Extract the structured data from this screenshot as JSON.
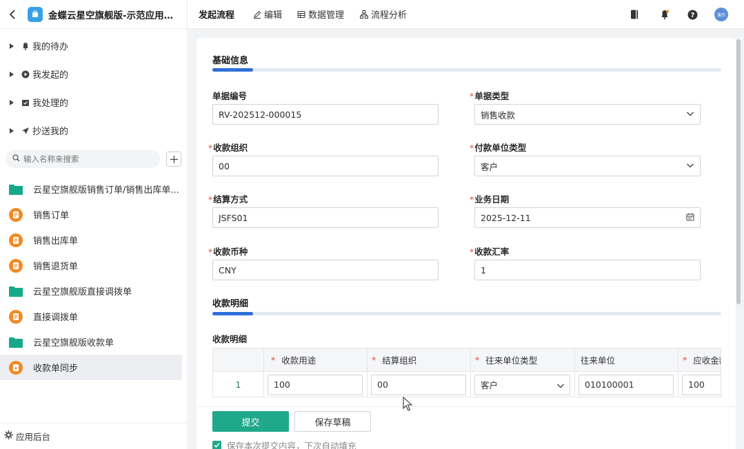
{
  "sidebar": {
    "app_title": "金蝶云星空旗舰版-示范应用_...",
    "nav": [
      {
        "label": "我的待办",
        "icon": "bell-icon"
      },
      {
        "label": "我发起的",
        "icon": "play-circle-icon"
      },
      {
        "label": "我处理的",
        "icon": "calendar-check-icon"
      },
      {
        "label": "抄送我的",
        "icon": "send-icon"
      }
    ],
    "search_placeholder": "输入名称来搜索",
    "docs": [
      {
        "label": "云星空旗舰版销售订单/销售出库单...",
        "icon": "folder-icon"
      },
      {
        "label": "销售订单",
        "icon": "form-icon"
      },
      {
        "label": "销售出库单",
        "icon": "form-icon"
      },
      {
        "label": "销售退货单",
        "icon": "form-icon"
      },
      {
        "label": "云星空旗舰版直接调拨单",
        "icon": "folder-icon"
      },
      {
        "label": "直接调拨单",
        "icon": "form-icon"
      },
      {
        "label": "云星空旗舰版收款单",
        "icon": "folder-icon"
      },
      {
        "label": "收款单同步",
        "icon": "sync-form-icon"
      }
    ],
    "footer_label": "应用后台"
  },
  "topbar": {
    "tabs": [
      {
        "label": "发起流程"
      },
      {
        "label": "编辑"
      },
      {
        "label": "数据管理"
      },
      {
        "label": "流程分析"
      }
    ],
    "avatar_text": "演示"
  },
  "form": {
    "section1_title": "基础信息",
    "fields": {
      "doc_no": {
        "label": "单据编号",
        "value": "RV-202512-000015"
      },
      "doc_type": {
        "label": "单据类型",
        "value": "销售收款"
      },
      "recv_org": {
        "label": "收款组织",
        "value": "00"
      },
      "payer_type": {
        "label": "付款单位类型",
        "value": "客户"
      },
      "settle_method": {
        "label": "结算方式",
        "value": "JSFS01"
      },
      "biz_date": {
        "label": "业务日期",
        "value": "2025-12-11"
      },
      "currency": {
        "label": "收款币种",
        "value": "CNY"
      },
      "rate": {
        "label": "收款汇率",
        "value": "1"
      }
    },
    "section2_title": "收款明细",
    "table_title": "收款明细",
    "table": {
      "headers": [
        "收款用途",
        "结算组织",
        "往来单位类型",
        "往来单位",
        "应收金额"
      ],
      "rows": [
        {
          "index": "1",
          "purpose": "100",
          "settle_org": "00",
          "partner_type": "客户",
          "partner": "010100001",
          "amount": "100"
        }
      ]
    }
  },
  "footer": {
    "submit_label": "提交",
    "draft_label": "保存草稿",
    "remember_label": "保存本次提交内容，下次自动填充"
  }
}
